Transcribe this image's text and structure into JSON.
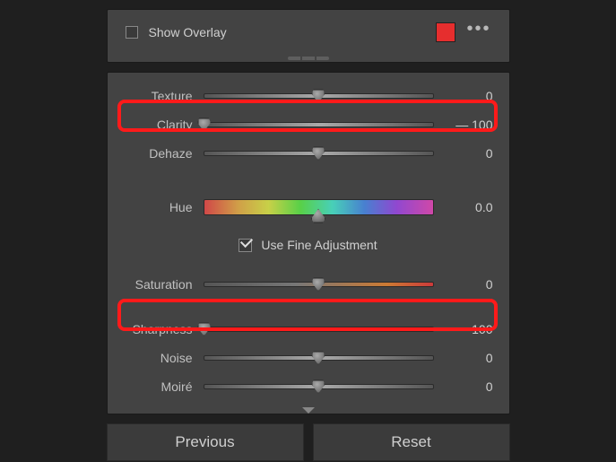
{
  "overlay": {
    "show_overlay_label": "Show Overlay",
    "swatch_color": "#e62e2e"
  },
  "sliders": {
    "texture": {
      "label": "Texture",
      "value": "0",
      "thumb_pct": 50
    },
    "clarity": {
      "label": "Clarity",
      "value": "— 100",
      "thumb_pct": 0
    },
    "dehaze": {
      "label": "Dehaze",
      "value": "0",
      "thumb_pct": 50
    },
    "hue": {
      "label": "Hue",
      "value": "0.0",
      "thumb_pct": 50
    },
    "fine_label": "Use Fine Adjustment",
    "saturation": {
      "label": "Saturation",
      "value": "0",
      "thumb_pct": 50
    },
    "sharpness": {
      "label": "Sharpness",
      "value": "— 100",
      "thumb_pct": 0
    },
    "noise": {
      "label": "Noise",
      "value": "0",
      "thumb_pct": 50
    },
    "moire": {
      "label": "Moiré",
      "value": "0",
      "thumb_pct": 50
    }
  },
  "buttons": {
    "previous": "Previous",
    "reset": "Reset"
  }
}
